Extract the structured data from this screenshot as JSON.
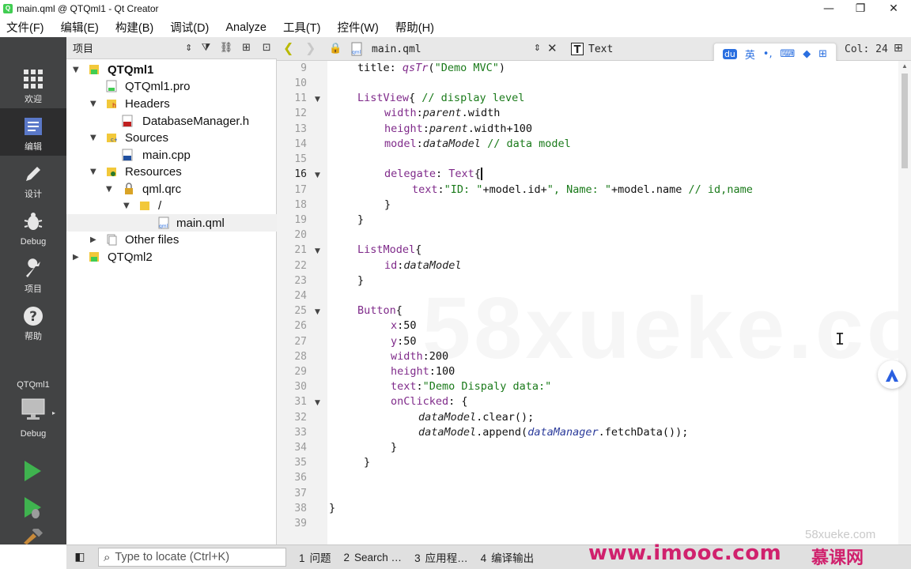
{
  "window": {
    "title": "main.qml @ QTQml1 - Qt Creator",
    "controls": [
      "—",
      "❐",
      "✕"
    ]
  },
  "menubar": {
    "items": [
      "文件(F)",
      "编辑(E)",
      "构建(B)",
      "调试(D)",
      "Analyze",
      "工具(T)",
      "控件(W)",
      "帮助(H)"
    ]
  },
  "modebar": {
    "modes": [
      {
        "label": "欢迎",
        "icon": "grid-icon"
      },
      {
        "label": "编辑",
        "icon": "document-icon"
      },
      {
        "label": "设计",
        "icon": "pencil-icon"
      },
      {
        "label": "Debug",
        "icon": "bug-icon"
      },
      {
        "label": "项目",
        "icon": "wrench-icon"
      },
      {
        "label": "帮助",
        "icon": "help-icon"
      }
    ],
    "kit": {
      "project": "QTQml1",
      "config": "Debug"
    }
  },
  "project_pane": {
    "title": "项目",
    "tree": [
      {
        "label": "QTQml1"
      },
      {
        "label": "QTQml1.pro"
      },
      {
        "label": "Headers"
      },
      {
        "label": "DatabaseManager.h"
      },
      {
        "label": "Sources"
      },
      {
        "label": "main.cpp"
      },
      {
        "label": "Resources"
      },
      {
        "label": "qml.qrc"
      },
      {
        "label": "/"
      },
      {
        "label": "main.qml"
      },
      {
        "label": "Other files"
      },
      {
        "label": "QTQml2"
      }
    ]
  },
  "editor_toolbar": {
    "file_name": "main.qml",
    "symbol": "Text",
    "cursor_col": "Col: 24"
  },
  "ime_toolbar": {
    "lang": "英"
  },
  "editor": {
    "lines": [
      {
        "n": "9"
      },
      {
        "n": "10"
      },
      {
        "n": "11"
      },
      {
        "n": "12"
      },
      {
        "n": "13"
      },
      {
        "n": "14"
      },
      {
        "n": "15"
      },
      {
        "n": "16"
      },
      {
        "n": "17"
      },
      {
        "n": "18"
      },
      {
        "n": "19"
      },
      {
        "n": "20"
      },
      {
        "n": "21"
      },
      {
        "n": "22"
      },
      {
        "n": "23"
      },
      {
        "n": "24"
      },
      {
        "n": "25"
      },
      {
        "n": "26"
      },
      {
        "n": "27"
      },
      {
        "n": "28"
      },
      {
        "n": "29"
      },
      {
        "n": "30"
      },
      {
        "n": "31"
      },
      {
        "n": "32"
      },
      {
        "n": "33"
      },
      {
        "n": "34"
      },
      {
        "n": "35"
      },
      {
        "n": "36"
      },
      {
        "n": "37"
      },
      {
        "n": "38"
      },
      {
        "n": "39"
      }
    ],
    "code": {
      "l9a": "title: ",
      "l9b": "qsTr",
      "l9c": "(",
      "l9d": "\"Demo MVC\"",
      "l9e": ")",
      "l11a": "ListView",
      "l11b": "{ ",
      "l11c": "// display level",
      "l12a": "width",
      "l12b": ":",
      "l12c": "parent",
      "l12d": ".width",
      "l13a": "height",
      "l13b": ":",
      "l13c": "parent",
      "l13d": ".width+100",
      "l14a": "model",
      "l14b": ":",
      "l14c": "dataModel",
      "l14d": " ",
      "l14e": "// data model",
      "l16a": "delegate",
      "l16b": ": ",
      "l16c": "Text",
      "l16d": "{",
      "l17a": "text",
      "l17b": ":",
      "l17c": "\"ID: \"",
      "l17d": "+model.id+",
      "l17e": "\", Name: \"",
      "l17f": "+model.name ",
      "l17g": "// id,name",
      "l18": "}",
      "l19": "}",
      "l21a": "ListModel",
      "l21b": "{",
      "l22a": "id",
      "l22b": ":",
      "l22c": "dataModel",
      "l23": "}",
      "l25a": "Button",
      "l25b": "{",
      "l26a": "x",
      "l26b": ":50",
      "l27a": "y",
      "l27b": ":50",
      "l28a": "width",
      "l28b": ":200",
      "l29a": "height",
      "l29b": ":100",
      "l30a": "text",
      "l30b": ":",
      "l30c": "\"Demo Dispaly data:\"",
      "l31a": "onClicked",
      "l31b": ": {",
      "l32a": "dataModel",
      "l32b": ".clear();",
      "l33a": "dataModel",
      "l33b": ".append(",
      "l33c": "dataManager",
      "l33d": ".fetchData());",
      "l34": "}",
      "l35": "}",
      "l38": "}"
    },
    "watermark": "58xueke.com"
  },
  "statusbar": {
    "locator_placeholder": "Type to locate (Ctrl+K)",
    "tabs": [
      {
        "num": "1",
        "label": "问题"
      },
      {
        "num": "2",
        "label": "Search …"
      },
      {
        "num": "3",
        "label": "应用程…"
      },
      {
        "num": "4",
        "label": "编译输出"
      }
    ],
    "brand_watermark": "www.imooc.com",
    "brand_watermark2": "58xueke.com",
    "brand_logo": "慕课网"
  },
  "colors": {
    "modebar_bg": "#424344",
    "keyword": "#7f2a8a",
    "string": "#1a7a1a",
    "brand": "#d0216d"
  }
}
